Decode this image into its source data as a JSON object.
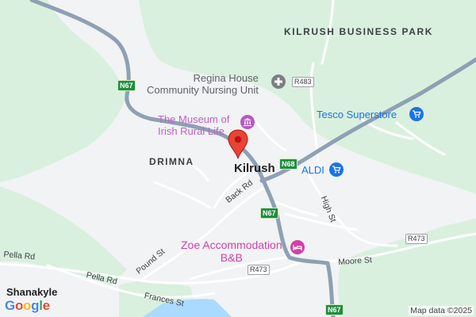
{
  "map": {
    "colors": {
      "land": "#f1f3f4",
      "green": "#d9f0de",
      "water": "#aadaff",
      "major_road": "#8ea0b4",
      "minor_road": "#ffffff",
      "pin": "#ea4335"
    },
    "areas": {
      "kilrush_business_park": "KILRUSH\nBUSINESS PARK",
      "drimna": "DRIMNA"
    },
    "towns": {
      "kilrush": "Kilrush",
      "shanakyle": "Shanakyle"
    },
    "pois": {
      "regina_house": "Regina House\nCommunity Nursing Unit",
      "museum": "The Museum of\nIrish Rural Life",
      "tesco": "Tesco Superstore",
      "aldi": "ALDI",
      "zoe": "Zoe Accommodation\nB&B"
    },
    "streets": {
      "back_rd": "Back Rd",
      "high_st": "High St",
      "pound_st": "Pound St",
      "pella_rd_1": "Pella Rd",
      "pella_rd_2": "Pella Rd",
      "frances_st": "Frances St",
      "moore_st": "Moore St"
    },
    "shields": {
      "n67_top": "N67",
      "n68": "N68",
      "n67_mid": "N67",
      "n67_bottom": "N67",
      "r483": "R483",
      "r473_right": "R473",
      "r473_mid": "R473"
    },
    "icons": {
      "regina_house": "medical-icon",
      "museum": "museum-icon",
      "tesco": "shopping-cart-icon",
      "aldi": "shopping-cart-icon",
      "zoe": "bed-icon"
    },
    "credit": "Map data ©2025",
    "logo": {
      "letters": [
        "G",
        "o",
        "o",
        "g",
        "l",
        "e"
      ],
      "colors": [
        "#4285f4",
        "#ea4335",
        "#fbbc05",
        "#4285f4",
        "#34a853",
        "#ea4335"
      ]
    }
  }
}
